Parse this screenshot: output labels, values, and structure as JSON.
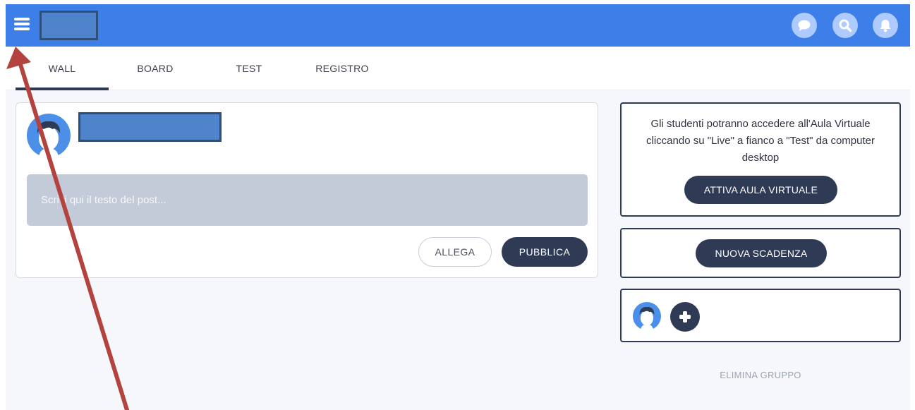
{
  "tabs": [
    {
      "label": "WALL",
      "active": true
    },
    {
      "label": "BOARD",
      "active": false
    },
    {
      "label": "TEST",
      "active": false
    },
    {
      "label": "REGISTRO",
      "active": false
    }
  ],
  "header": {
    "icons": [
      "menu-icon",
      "chat-icon",
      "search-icon",
      "bell-icon"
    ]
  },
  "post": {
    "placeholder": "Scrivi qui il testo del post...",
    "attach_label": "ALLEGA",
    "publish_label": "PUBBLICA"
  },
  "aula": {
    "text": "Gli studenti potranno accedere all'Aula Virtuale cliccando su \"Live\" a fianco a \"Test\" da computer desktop",
    "button_label": "ATTIVA AULA VIRTUALE"
  },
  "scadenza": {
    "button_label": "NUOVA SCADENZA"
  },
  "group": {
    "delete_label": "ELIMINA GRUPPO"
  },
  "colors": {
    "topbar": "#3d7ee8",
    "dark_button": "#2f3b55",
    "input_bg": "#c3cad8",
    "annotation_arrow": "#b3433f"
  }
}
